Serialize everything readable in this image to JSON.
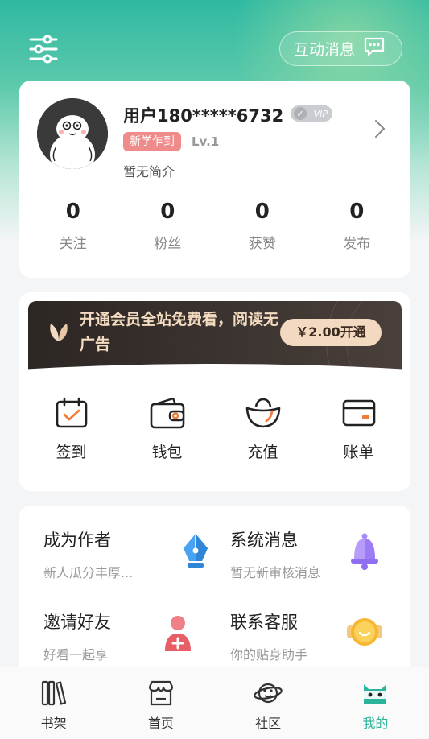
{
  "header": {
    "messages_label": "互动消息"
  },
  "profile": {
    "username": "用户180*****6732",
    "vip_badge": "VIP",
    "tag": "新学乍到",
    "level": "Lv.1",
    "bio": "暂无简介",
    "stats": [
      {
        "value": "0",
        "label": "关注"
      },
      {
        "value": "0",
        "label": "粉丝"
      },
      {
        "value": "0",
        "label": "获赞"
      },
      {
        "value": "0",
        "label": "发布"
      }
    ]
  },
  "vip_banner": {
    "text": "开通会员全站免费看，阅读无广告",
    "button": "￥2.00开通"
  },
  "wallet_tools": [
    {
      "label": "签到",
      "icon": "calendar-check-icon"
    },
    {
      "label": "钱包",
      "icon": "wallet-icon"
    },
    {
      "label": "充值",
      "icon": "gold-ingot-icon"
    },
    {
      "label": "账单",
      "icon": "card-icon"
    }
  ],
  "services": [
    {
      "title": "成为作者",
      "subtitle": "新人瓜分丰厚...",
      "icon": "pen-nib-icon"
    },
    {
      "title": "系统消息",
      "subtitle": "暂无新审核消息",
      "icon": "bell-icon"
    },
    {
      "title": "邀请好友",
      "subtitle": "好看一起享",
      "icon": "add-user-icon"
    },
    {
      "title": "联系客服",
      "subtitle": "你的贴身助手",
      "icon": "headset-icon"
    }
  ],
  "tabbar": [
    {
      "label": "书架",
      "icon": "bookshelf-icon",
      "active": false
    },
    {
      "label": "首页",
      "icon": "store-icon",
      "active": false
    },
    {
      "label": "社区",
      "icon": "planet-icon",
      "active": false
    },
    {
      "label": "我的",
      "icon": "mascot-icon",
      "active": true
    }
  ],
  "colors": {
    "brand": "#2bb39b",
    "tag_bg": "#f08b8b",
    "vip_banner_bg": "#2c2624",
    "vip_gold": "#f3d9bf"
  }
}
